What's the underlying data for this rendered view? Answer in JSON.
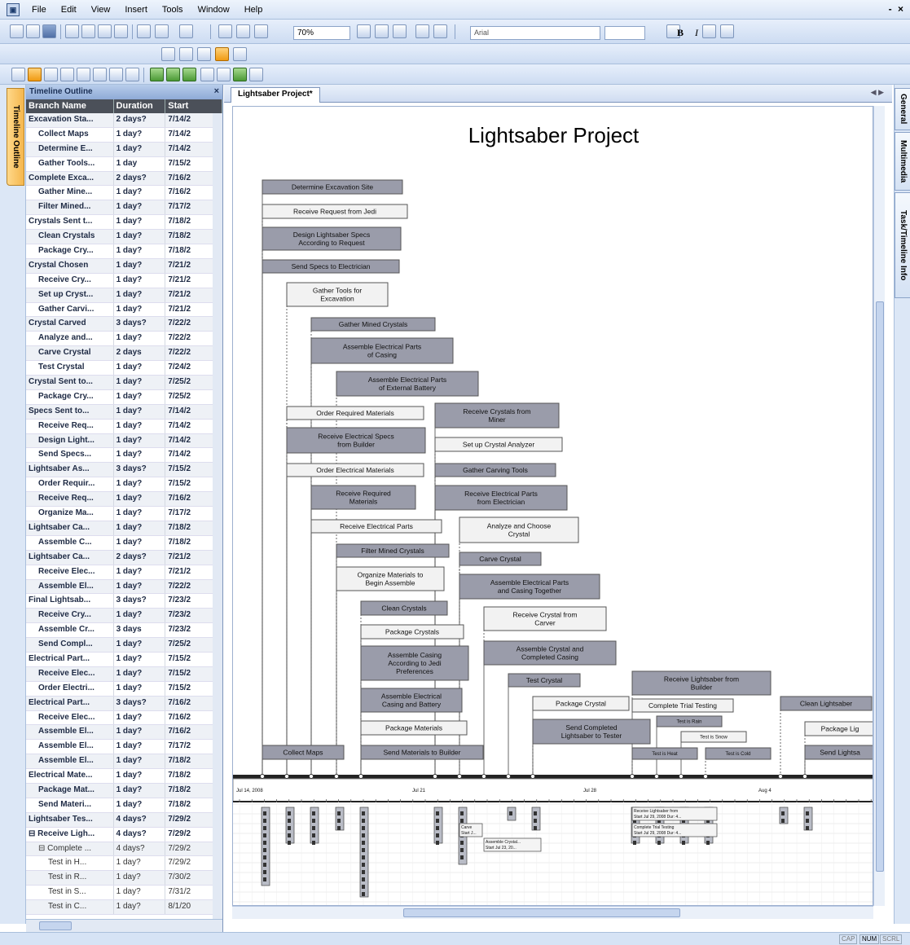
{
  "menu": [
    "File",
    "Edit",
    "View",
    "Insert",
    "Tools",
    "Window",
    "Help"
  ],
  "window_controls": "- ×",
  "toolbar": {
    "zoom": "70%",
    "font": "Arial",
    "bold": "B",
    "italic": "I"
  },
  "left_tab": "Timeline Outline",
  "outline": {
    "title": "Timeline Outline",
    "headers": [
      "Branch Name",
      "Duration",
      "Start"
    ],
    "rows": [
      [
        "Excavation Sta...",
        "2 days?",
        "7/14/2"
      ],
      [
        "Collect Maps",
        "1 day?",
        "7/14/2"
      ],
      [
        "Determine E...",
        "1 day?",
        "7/14/2"
      ],
      [
        "Gather Tools...",
        "1 day",
        "7/15/2"
      ],
      [
        "Complete Exca...",
        "2 days?",
        "7/16/2"
      ],
      [
        "Gather Mine...",
        "1 day?",
        "7/16/2"
      ],
      [
        "Filter Mined...",
        "1 day?",
        "7/17/2"
      ],
      [
        "Crystals Sent t...",
        "1 day?",
        "7/18/2"
      ],
      [
        "Clean Crystals",
        "1 day?",
        "7/18/2"
      ],
      [
        "Package Cry...",
        "1 day?",
        "7/18/2"
      ],
      [
        "Crystal Chosen",
        "1 day?",
        "7/21/2"
      ],
      [
        "Receive Cry...",
        "1 day?",
        "7/21/2"
      ],
      [
        "Set up Cryst...",
        "1 day?",
        "7/21/2"
      ],
      [
        "Gather Carvi...",
        "1 day?",
        "7/21/2"
      ],
      [
        "Crystal Carved",
        "3 days?",
        "7/22/2"
      ],
      [
        "Analyze and...",
        "1 day?",
        "7/22/2"
      ],
      [
        "Carve Crystal",
        "2 days",
        "7/22/2"
      ],
      [
        "Test Crystal",
        "1 day?",
        "7/24/2"
      ],
      [
        "Crystal Sent to...",
        "1 day?",
        "7/25/2"
      ],
      [
        "Package Cry...",
        "1 day?",
        "7/25/2"
      ],
      [
        "Specs Sent to...",
        "1 day?",
        "7/14/2"
      ],
      [
        "Receive Req...",
        "1 day?",
        "7/14/2"
      ],
      [
        "Design Light...",
        "1 day?",
        "7/14/2"
      ],
      [
        "Send Specs...",
        "1 day?",
        "7/14/2"
      ],
      [
        "Lightsaber As...",
        "3 days?",
        "7/15/2"
      ],
      [
        "Order Requir...",
        "1 day?",
        "7/15/2"
      ],
      [
        "Receive Req...",
        "1 day?",
        "7/16/2"
      ],
      [
        "Organize Ma...",
        "1 day?",
        "7/17/2"
      ],
      [
        "Lightsaber Ca...",
        "1 day?",
        "7/18/2"
      ],
      [
        "Assemble C...",
        "1 day?",
        "7/18/2"
      ],
      [
        "Lightsaber Ca...",
        "2 days?",
        "7/21/2"
      ],
      [
        "Receive Elec...",
        "1 day?",
        "7/21/2"
      ],
      [
        "Assemble El...",
        "1 day?",
        "7/22/2"
      ],
      [
        "Final Lightsab...",
        "3 days?",
        "7/23/2"
      ],
      [
        "Receive Cry...",
        "1 day?",
        "7/23/2"
      ],
      [
        "Assemble Cr...",
        "3 days",
        "7/23/2"
      ],
      [
        "Send Compl...",
        "1 day?",
        "7/25/2"
      ],
      [
        "Electrical Part...",
        "1 day?",
        "7/15/2"
      ],
      [
        "Receive Elec...",
        "1 day?",
        "7/15/2"
      ],
      [
        "Order Electri...",
        "1 day?",
        "7/15/2"
      ],
      [
        "Electrical Part...",
        "3 days?",
        "7/16/2"
      ],
      [
        "Receive Elec...",
        "1 day?",
        "7/16/2"
      ],
      [
        "Assemble El...",
        "1 day?",
        "7/16/2"
      ],
      [
        "Assemble El...",
        "1 day?",
        "7/17/2"
      ],
      [
        "Assemble El...",
        "1 day?",
        "7/18/2"
      ],
      [
        "Electrical Mate...",
        "1 day?",
        "7/18/2"
      ],
      [
        "Package Mat...",
        "1 day?",
        "7/18/2"
      ],
      [
        "Send Materi...",
        "1 day?",
        "7/18/2"
      ],
      [
        "Lightsaber Tes...",
        "4 days?",
        "7/29/2"
      ],
      [
        "⊟ Receive Ligh...",
        "4 days?",
        "7/29/2"
      ],
      [
        "⊟ Complete ...",
        "4 days?",
        "7/29/2"
      ],
      [
        "Test in H...",
        "1 day?",
        "7/29/2"
      ],
      [
        "Test in R...",
        "1 day?",
        "7/30/2"
      ],
      [
        "Test in S...",
        "1 day?",
        "7/31/2"
      ],
      [
        "Test in C...",
        "1 day?",
        "8/1/20"
      ]
    ]
  },
  "doc_tab": "Lightsaber Project*",
  "chart_title": "Lightsaber Project",
  "right_tabs": [
    "General",
    "Multimedia",
    "Task/Timeline Info"
  ],
  "axis_labels": [
    "Jul 14, 2008",
    "Jul 21",
    "Jul 28",
    "Aug 4"
  ],
  "status": [
    "CAP",
    "NUM",
    "SCRL"
  ],
  "events": [
    "Determine Excavation Site",
    "Receive Request from Jedi",
    "Design Lightsaber Specs\nAccording to Request",
    "Send Specs to Electrician",
    "Gather Tools for\nExcavation",
    "Gather Mined Crystals",
    "Assemble Electrical Parts\nof Casing",
    "Assemble Electrical Parts\nof External Battery",
    "Order Required Materials",
    "Receive Crystals from\nMiner",
    "Receive Electrical Specs\nfrom Builder",
    "Set up Crystal Analyzer",
    "Order Electrical Materials",
    "Gather Carving Tools",
    "Receive Required\nMaterials",
    "Receive Electrical Parts\nfrom Electrician",
    "Receive Electrical Parts",
    "Analyze and Choose\nCrystal",
    "Filter Mined Crystals",
    "Carve Crystal",
    "Organize Materials to\nBegin Assemble",
    "Assemble Electrical Parts\nand Casing Together",
    "Clean Crystals",
    "Receive Crystal from\nCarver",
    "Package Crystals",
    "Assemble Crystal and\nCompleted Casing",
    "Assemble Casing\nAccording to Jedi\nPreferences",
    "Test Crystal",
    "Receive Lightsaber from\nBuilder",
    "Assemble Electrical\nCasing and Battery",
    "Package Crystal",
    "Complete Trial Testing",
    "Clean Lightsaber",
    "Test is Rain",
    "Package Materials",
    "Send Completed\nLightsaber to Tester",
    "Test is Snow",
    "Package Lig",
    "Collect Maps",
    "Send Materials to Builder",
    "Test is Heat",
    "Test is Cold",
    "Send Lightsa"
  ],
  "lower_notes": [
    "Receive Lightsaber from\nStart Jul 29, 2008 Dur: 4...",
    "Complete Trial Testing\nStart Jul 29, 2008 Dur: 4...",
    "Assemble Crystal...\nStart Jul 23, 20...",
    "Carve\nStart J..."
  ]
}
